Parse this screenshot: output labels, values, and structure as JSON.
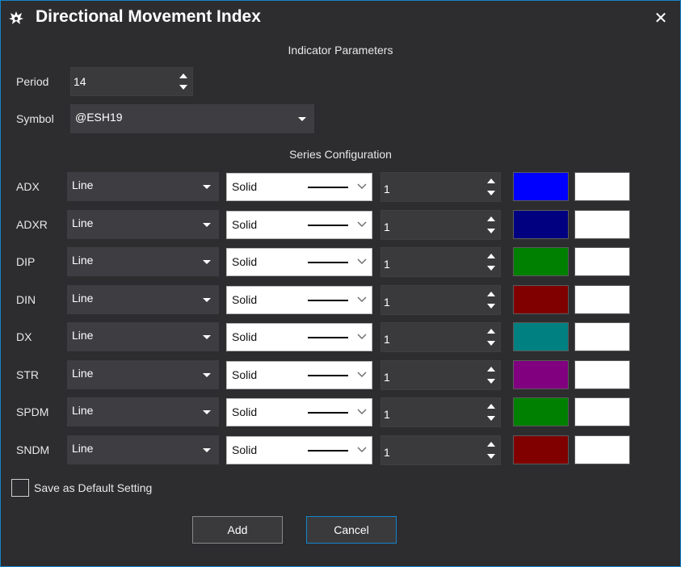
{
  "window": {
    "title": "Directional Movement Index",
    "close_glyph": "✕"
  },
  "indicator_params": {
    "heading": "Indicator Parameters",
    "period": {
      "label": "Period",
      "value": "14"
    },
    "symbol": {
      "label": "Symbol",
      "value": "@ESH19"
    }
  },
  "series_config": {
    "heading": "Series Configuration",
    "rows": [
      {
        "name": "ADX",
        "type": "Line",
        "style": "Solid",
        "width": "1",
        "color": "#0000ff",
        "bg_color": "#ffffff"
      },
      {
        "name": "ADXR",
        "type": "Line",
        "style": "Solid",
        "width": "1",
        "color": "#000080",
        "bg_color": "#ffffff"
      },
      {
        "name": "DIP",
        "type": "Line",
        "style": "Solid",
        "width": "1",
        "color": "#008000",
        "bg_color": "#ffffff"
      },
      {
        "name": "DIN",
        "type": "Line",
        "style": "Solid",
        "width": "1",
        "color": "#800000",
        "bg_color": "#ffffff"
      },
      {
        "name": "DX",
        "type": "Line",
        "style": "Solid",
        "width": "1",
        "color": "#008080",
        "bg_color": "#ffffff"
      },
      {
        "name": "STR",
        "type": "Line",
        "style": "Solid",
        "width": "1",
        "color": "#800080",
        "bg_color": "#ffffff"
      },
      {
        "name": "SPDM",
        "type": "Line",
        "style": "Solid",
        "width": "1",
        "color": "#008000",
        "bg_color": "#ffffff"
      },
      {
        "name": "SNDM",
        "type": "Line",
        "style": "Solid",
        "width": "1",
        "color": "#800000",
        "bg_color": "#ffffff"
      }
    ]
  },
  "save_default": {
    "label": "Save as Default Setting",
    "checked": false
  },
  "buttons": {
    "add": "Add",
    "cancel": "Cancel"
  },
  "colors": {
    "accent": "#1585c9",
    "background": "#2d2d30"
  }
}
